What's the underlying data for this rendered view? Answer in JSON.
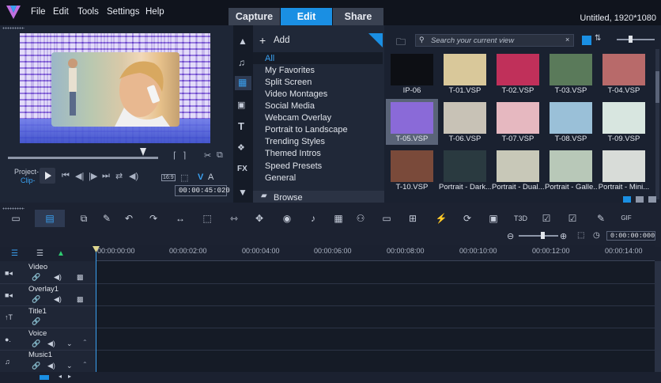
{
  "menu": {
    "items": [
      "File",
      "Edit",
      "Tools",
      "Settings",
      "Help"
    ]
  },
  "tabs": {
    "capture": "Capture",
    "edit": "Edit",
    "share": "Share"
  },
  "project_title": "Untitled, 1920*1080",
  "preview": {
    "project_label": "Project-",
    "clip_label": "Clip-",
    "timecode": "00:00:45:020",
    "aspect": "16:9",
    "v_label": "V",
    "a_label": "A"
  },
  "library": {
    "add_label": "Add",
    "categories": [
      "All",
      "My Favorites",
      "Split Screen",
      "Video Montages",
      "Social Media",
      "Webcam Overlay",
      "Portrait to Landscape",
      "Trending Styles",
      "Themed Intros",
      "Speed Presets",
      "General"
    ],
    "browse_label": "Browse",
    "search_placeholder": "Search your current view",
    "items": [
      {
        "label": "IP-06",
        "color": "#0d0f14"
      },
      {
        "label": "T-01.VSP",
        "color": "#d9c89a"
      },
      {
        "label": "T-02.VSP",
        "color": "#c0305a"
      },
      {
        "label": "T-03.VSP",
        "color": "#5a7a5a"
      },
      {
        "label": "T-04.VSP",
        "color": "#b86a6a"
      },
      {
        "label": "T-05.VSP",
        "color": "#8a6ad8"
      },
      {
        "label": "T-06.VSP",
        "color": "#c8c2b6"
      },
      {
        "label": "T-07.VSP",
        "color": "#e6b8c0"
      },
      {
        "label": "T-08.VSP",
        "color": "#9ac0d8"
      },
      {
        "label": "T-09.VSP",
        "color": "#d8e6e0"
      },
      {
        "label": "T-10.VSP",
        "color": "#7a4a3a"
      },
      {
        "label": "Portrait - Dark...",
        "color": "#2a3a40"
      },
      {
        "label": "Portrait - Dual...",
        "color": "#c8c8b8"
      },
      {
        "label": "Portrait - Galle...",
        "color": "#b8c8b8"
      },
      {
        "label": "Portrait - Mini...",
        "color": "#d8dcd8"
      }
    ]
  },
  "timeline": {
    "timecode": "0:00:00:000",
    "ruler_ticks": [
      "00:00:00:00",
      "00:00:02:00",
      "00:00:04:00",
      "00:00:06:00",
      "00:00:08:00",
      "00:00:10:00",
      "00:00:12:00",
      "00:00:14:00"
    ],
    "tracks": [
      "Video",
      "Overlay1",
      "Title1",
      "Voice",
      "Music1"
    ]
  },
  "colors": {
    "accent": "#1a8fe3",
    "background": "#1b2130"
  }
}
